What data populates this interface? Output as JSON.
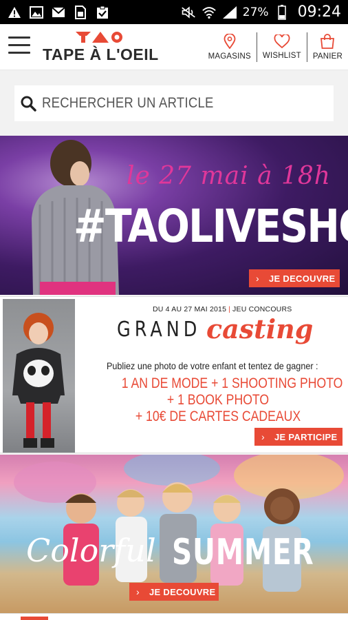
{
  "status_bar": {
    "battery_percent": "27%",
    "time": "09:24",
    "icons": [
      "warning-icon",
      "image-icon",
      "mail-icon",
      "sim-icon",
      "clipboard-check-icon",
      "mute-icon",
      "wifi-icon",
      "signal-icon",
      "battery-icon"
    ]
  },
  "header": {
    "logo_mark": "TAO",
    "logo_text": "TAPE À L'OEIL",
    "actions": [
      {
        "label": "MAGASINS",
        "icon": "location-pin-icon"
      },
      {
        "label": "WISHLIST",
        "icon": "heart-icon"
      },
      {
        "label": "PANIER",
        "icon": "shopping-bag-icon"
      }
    ],
    "accent": "#e84a36"
  },
  "search": {
    "placeholder": "RECHERCHER UN ARTICLE"
  },
  "banners": {
    "live": {
      "date": "le 27 mai à 18h",
      "hashtag": "#TAOLIVESHOW",
      "cta": "JE DECOUVRE"
    },
    "casting": {
      "dates": "DU 4 AU 27 MAI 2015",
      "dates_sep": "|",
      "dates_tag": "JEU CONCOURS",
      "title_a": "GRAND",
      "title_b": "casting",
      "subtitle": "Publiez une photo de votre enfant et tentez de gagner :",
      "line1": "1 AN DE MODE + 1 SHOOTING PHOTO",
      "line2": "+ 1 BOOK PHOTO",
      "line3": "+ 10€ DE CARTES CADEAUX",
      "cta": "JE PARTICIPE"
    },
    "summer": {
      "title_a": "Colorful",
      "title_b": "SUMMER",
      "cta": "JE DECOUVRE"
    }
  }
}
